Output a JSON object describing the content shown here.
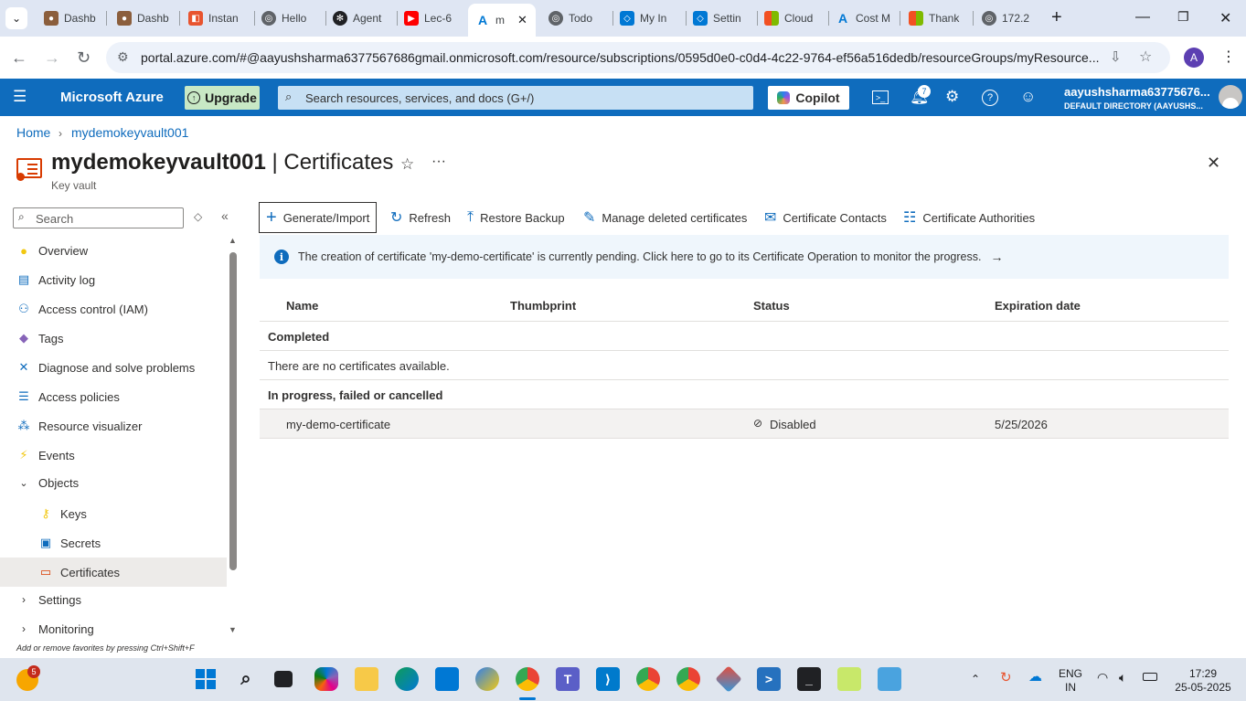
{
  "browser": {
    "tabs": [
      {
        "label": "Dashb",
        "color": "#8b5e3c"
      },
      {
        "label": "Dashb",
        "color": "#8b5e3c"
      },
      {
        "label": "Instan",
        "color": "#e8542f"
      },
      {
        "label": "Hello",
        "color": "#5f6368"
      },
      {
        "label": "Agent",
        "color": "#202124"
      },
      {
        "label": "Lec-6",
        "color": "#ff0000"
      },
      {
        "label": "m",
        "color": "#0078d4"
      },
      {
        "label": "Todo",
        "color": "#5f6368"
      },
      {
        "label": "My In",
        "color": "#0078d4"
      },
      {
        "label": "Settin",
        "color": "#0078d4"
      },
      {
        "label": "Cloud",
        "color": "#f25022"
      },
      {
        "label": "Cost M",
        "color": "#0078d4"
      },
      {
        "label": "Thank",
        "color": "#f25022"
      },
      {
        "label": "172.2",
        "color": "#5f6368"
      }
    ],
    "url": "portal.azure.com/#@aayushsharma6377567686gmail.onmicrosoft.com/resource/subscriptions/0595d0e0-c0d4-4c22-9764-ef56a516dedb/resourceGroups/myResource...",
    "profile_initial": "A"
  },
  "azure": {
    "brand": "Microsoft Azure",
    "upgrade_label": "Upgrade",
    "search_placeholder": "Search resources, services, and docs (G+/)",
    "copilot_label": "Copilot",
    "notification_count": "7",
    "account_name": "aayushsharma63775676...",
    "account_directory": "DEFAULT DIRECTORY (AAYUSHS..."
  },
  "breadcrumb": {
    "home": "Home",
    "vault": "mydemokeyvault001"
  },
  "page": {
    "title_resource": "mydemokeyvault001",
    "title_section": " | Certificates",
    "subtitle": "Key vault"
  },
  "nav": {
    "search_placeholder": "Search",
    "items": [
      {
        "label": "Overview"
      },
      {
        "label": "Activity log"
      },
      {
        "label": "Access control (IAM)"
      },
      {
        "label": "Tags"
      },
      {
        "label": "Diagnose and solve problems"
      },
      {
        "label": "Access policies"
      },
      {
        "label": "Resource visualizer"
      },
      {
        "label": "Events"
      },
      {
        "label": "Objects"
      },
      {
        "label": "Keys"
      },
      {
        "label": "Secrets"
      },
      {
        "label": "Certificates"
      },
      {
        "label": "Settings"
      },
      {
        "label": "Monitoring"
      }
    ],
    "footer_hint": "Add or remove favorites by pressing Ctrl+Shift+F"
  },
  "toolbar": {
    "generate_import": "Generate/Import",
    "refresh": "Refresh",
    "restore_backup": "Restore Backup",
    "manage_deleted": "Manage deleted certificates",
    "contacts": "Certificate Contacts",
    "authorities": "Certificate Authorities"
  },
  "banner": {
    "text": "The creation of certificate 'my-demo-certificate' is currently pending. Click here to go to its Certificate Operation to monitor the progress."
  },
  "table": {
    "columns": [
      "Name",
      "Thumbprint",
      "Status",
      "Expiration date"
    ],
    "group_completed": "Completed",
    "empty_message": "There are no certificates available.",
    "group_in_progress": "In progress, failed or cancelled",
    "rows": [
      {
        "name": "my-demo-certificate",
        "thumbprint": "",
        "status": "Disabled",
        "expiration": "5/25/2026"
      }
    ]
  },
  "taskbar": {
    "widget_badge": "5",
    "language": "ENG",
    "region": "IN",
    "time": "17:29",
    "date": "25-05-2025"
  },
  "colors": {
    "azure_blue": "#0f6cbd",
    "banner_bg": "#eff6fc",
    "upgrade_bg": "#c8e8c5"
  }
}
